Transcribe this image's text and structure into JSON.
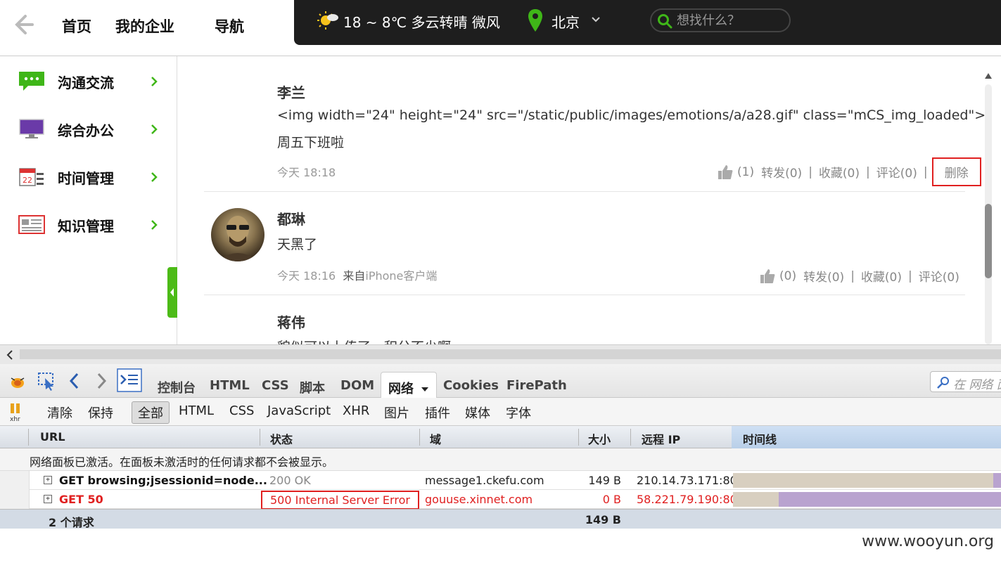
{
  "topnav": {
    "items": [
      "首页",
      "我的企业",
      "导航"
    ]
  },
  "weather": {
    "text": "18 ~ 8℃  多云转晴  微风",
    "city": "北京"
  },
  "search": {
    "placeholder": "想找什么？"
  },
  "sidebar": {
    "items": [
      {
        "label": "沟通交流",
        "icon": "chat-icon"
      },
      {
        "label": "综合办公",
        "icon": "monitor-icon"
      },
      {
        "label": "时间管理",
        "icon": "calendar-icon"
      },
      {
        "label": "知识管理",
        "icon": "newspaper-icon"
      }
    ]
  },
  "posts": [
    {
      "name": "李兰",
      "text_line1": "<img width=\"24\" height=\"24\" src=\"/static/public/images/emotions/a/a28.gif\" class=\"mCS_img_loaded\">",
      "text_line2": "周五下班啦",
      "time": "今天 18:18",
      "likes": "(1)",
      "forward": "转发(0)",
      "collect": "收藏(0)",
      "comment": "评论(0)",
      "delete": "删除"
    },
    {
      "name": "都琳",
      "text_line1": "天黑了",
      "time": "今天 18:16",
      "source_prefix": "来自",
      "source": "iPhone客户端",
      "likes": "(0)",
      "forward": "转发(0)",
      "collect": "收藏(0)",
      "comment": "评论(0)"
    },
    {
      "name": "蒋伟",
      "text_line1": "貌似可以上传了，积分不少啊"
    }
  ],
  "firebug": {
    "tabs": [
      "控制台",
      "HTML",
      "CSS",
      "脚本",
      "DOM",
      "网络",
      "Cookies",
      "FirePath"
    ],
    "active_tab": "网络",
    "search_placeholder": "在 网络 面",
    "filters": [
      "清除",
      "保持",
      "全部",
      "HTML",
      "CSS",
      "JavaScript",
      "XHR",
      "图片",
      "插件",
      "媒体",
      "字体"
    ],
    "active_filter": "全部",
    "columns": [
      "URL",
      "状态",
      "域",
      "大小",
      "远程 IP",
      "时间线"
    ],
    "info": "网络面板已激活。在面板未激活时的任何请求都不会被显示。",
    "requests": [
      {
        "url": "GET browsing;jsessionid=node...",
        "status": "200 OK",
        "domain": "message1.ckefu.com",
        "size": "149 B",
        "ip": "210.14.73.171:80",
        "error": false,
        "timeline_start": 0.97,
        "timeline_len": 0.03
      },
      {
        "url": "GET 50",
        "status": "500 Internal Server Error",
        "domain": "gouuse.xinnet.com",
        "size": "0 B",
        "ip": "58.221.79.190:80",
        "error": true,
        "timeline_start": 0.17,
        "timeline_len": 0.83
      }
    ],
    "footer_count": "2 个请求",
    "footer_size": "149 B"
  },
  "watermark": "www.wooyun.org",
  "colors": {
    "accent_green": "#4cbb17",
    "error_red": "#e02020",
    "dark_bar": "#1e1e1e"
  }
}
